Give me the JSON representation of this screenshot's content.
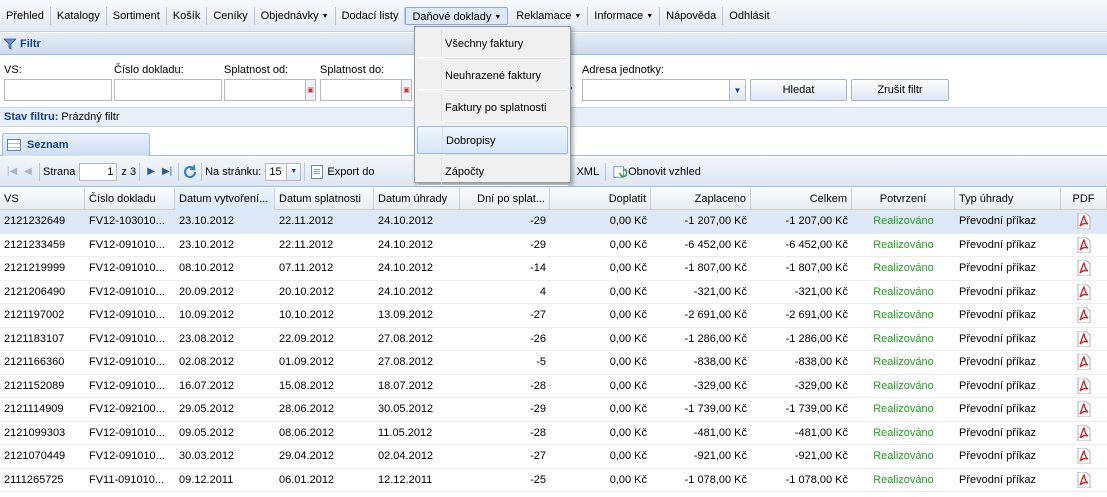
{
  "nav": [
    {
      "label": "Přehled",
      "caret": ""
    },
    {
      "label": "Katalogy",
      "caret": ""
    },
    {
      "label": "Sortiment",
      "caret": ""
    },
    {
      "label": "Košík",
      "caret": ""
    },
    {
      "label": "Ceníky",
      "caret": ""
    },
    {
      "label": "Objednávky",
      "caret": "▼"
    },
    {
      "label": "Dodací listy",
      "caret": ""
    },
    {
      "label": "Daňové doklady",
      "caret": "▼"
    },
    {
      "label": "Reklamace",
      "caret": "▼"
    },
    {
      "label": "Informace",
      "caret": "▼"
    },
    {
      "label": "Nápověda",
      "caret": ""
    },
    {
      "label": "Odhlásit",
      "caret": ""
    }
  ],
  "menu": {
    "items": [
      "Všechny faktury",
      "Neuhrazené faktury",
      "Faktury po splatnosti",
      "Dobropisy",
      "Zápočty"
    ]
  },
  "filter": {
    "title": "Filtr",
    "labels": {
      "vs": "VS:",
      "cislo": "Číslo dokladu:",
      "od": "Splatnost od:",
      "do": "Splatnost do:",
      "adresa": "Adresa jednotky:"
    },
    "search_button": "Hledat",
    "clear_button": "Zrušit filtr",
    "status_label": "Stav filtru:",
    "status_value": "Prázdný filtr"
  },
  "tab": {
    "label": "Seznam"
  },
  "toolbar": {
    "page_label": "Strana",
    "page_value": "1",
    "page_of": "z 3",
    "per_page_label": "Na stránku:",
    "per_page_value": "15",
    "export_label": "Export do",
    "xml_label": "XML",
    "refresh_label": "Obnovit vzhled"
  },
  "columns": [
    "VS",
    "Číslo dokladu",
    "Datum vytvoření...",
    "Datum splatnosti",
    "Datum úhrady",
    "Dní po splat...",
    "Doplatit",
    "Zaplaceno",
    "Celkem",
    "Potvrzení",
    "Typ úhrady",
    "PDF"
  ],
  "rows": [
    {
      "vs": "2121232649",
      "cislo": "FV12-103010...",
      "vytvoreni": "23.10.2012",
      "splatnost": "22.11.2012",
      "uhrada": "24.10.2012",
      "dni": "-29",
      "doplatit": "0,00 Kč",
      "zaplaceno": "-1 207,00 Kč",
      "celkem": "-1 207,00 Kč",
      "potvrzeni": "Realizováno",
      "typ": "Převodní příkaz"
    },
    {
      "vs": "2121233459",
      "cislo": "FV12-091010...",
      "vytvoreni": "23.10.2012",
      "splatnost": "22.11.2012",
      "uhrada": "24.10.2012",
      "dni": "-29",
      "doplatit": "0,00 Kč",
      "zaplaceno": "-6 452,00 Kč",
      "celkem": "-6 452,00 Kč",
      "potvrzeni": "Realizováno",
      "typ": "Převodní příkaz"
    },
    {
      "vs": "2121219999",
      "cislo": "FV12-091010...",
      "vytvoreni": "08.10.2012",
      "splatnost": "07.11.2012",
      "uhrada": "24.10.2012",
      "dni": "-14",
      "doplatit": "0,00 Kč",
      "zaplaceno": "-1 807,00 Kč",
      "celkem": "-1 807,00 Kč",
      "potvrzeni": "Realizováno",
      "typ": "Převodní příkaz"
    },
    {
      "vs": "2121206490",
      "cislo": "FV12-091010...",
      "vytvoreni": "20.09.2012",
      "splatnost": "20.10.2012",
      "uhrada": "24.10.2012",
      "dni": "4",
      "doplatit": "0,00 Kč",
      "zaplaceno": "-321,00 Kč",
      "celkem": "-321,00 Kč",
      "potvrzeni": "Realizováno",
      "typ": "Převodní příkaz"
    },
    {
      "vs": "2121197002",
      "cislo": "FV12-091010...",
      "vytvoreni": "10.09.2012",
      "splatnost": "10.10.2012",
      "uhrada": "13.09.2012",
      "dni": "-27",
      "doplatit": "0,00 Kč",
      "zaplaceno": "-2 691,00 Kč",
      "celkem": "-2 691,00 Kč",
      "potvrzeni": "Realizováno",
      "typ": "Převodní příkaz"
    },
    {
      "vs": "2121183107",
      "cislo": "FV12-091010...",
      "vytvoreni": "23.08.2012",
      "splatnost": "22.09.2012",
      "uhrada": "27.08.2012",
      "dni": "-26",
      "doplatit": "0,00 Kč",
      "zaplaceno": "-1 286,00 Kč",
      "celkem": "-1 286,00 Kč",
      "potvrzeni": "Realizováno",
      "typ": "Převodní příkaz"
    },
    {
      "vs": "2121166360",
      "cislo": "FV12-091010...",
      "vytvoreni": "02.08.2012",
      "splatnost": "01.09.2012",
      "uhrada": "27.08.2012",
      "dni": "-5",
      "doplatit": "0,00 Kč",
      "zaplaceno": "-838,00 Kč",
      "celkem": "-838,00 Kč",
      "potvrzeni": "Realizováno",
      "typ": "Převodní příkaz"
    },
    {
      "vs": "2121152089",
      "cislo": "FV12-091010...",
      "vytvoreni": "16.07.2012",
      "splatnost": "15.08.2012",
      "uhrada": "18.07.2012",
      "dni": "-28",
      "doplatit": "0,00 Kč",
      "zaplaceno": "-329,00 Kč",
      "celkem": "-329,00 Kč",
      "potvrzeni": "Realizováno",
      "typ": "Převodní příkaz"
    },
    {
      "vs": "2121114909",
      "cislo": "FV12-092100...",
      "vytvoreni": "29.05.2012",
      "splatnost": "28.06.2012",
      "uhrada": "30.05.2012",
      "dni": "-29",
      "doplatit": "0,00 Kč",
      "zaplaceno": "-1 739,00 Kč",
      "celkem": "-1 739,00 Kč",
      "potvrzeni": "Realizováno",
      "typ": "Převodní příkaz"
    },
    {
      "vs": "2121099303",
      "cislo": "FV12-091010...",
      "vytvoreni": "09.05.2012",
      "splatnost": "08.06.2012",
      "uhrada": "11.05.2012",
      "dni": "-28",
      "doplatit": "0,00 Kč",
      "zaplaceno": "-481,00 Kč",
      "celkem": "-481,00 Kč",
      "potvrzeni": "Realizováno",
      "typ": "Převodní příkaz"
    },
    {
      "vs": "2121070449",
      "cislo": "FV12-091010...",
      "vytvoreni": "30.03.2012",
      "splatnost": "29.04.2012",
      "uhrada": "02.04.2012",
      "dni": "-27",
      "doplatit": "0,00 Kč",
      "zaplaceno": "-921,00 Kč",
      "celkem": "-921,00 Kč",
      "potvrzeni": "Realizováno",
      "typ": "Převodní příkaz"
    },
    {
      "vs": "2111265725",
      "cislo": "FV11-091010...",
      "vytvoreni": "09.12.2011",
      "splatnost": "06.01.2012",
      "uhrada": "12.12.2011",
      "dni": "-25",
      "doplatit": "0,00 Kč",
      "zaplaceno": "-1 078,00 Kč",
      "celkem": "-1 078,00 Kč",
      "potvrzeni": "Realizováno",
      "typ": "Převodní příkaz"
    }
  ],
  "colors": {
    "accent": "#15428b",
    "confirmed": "#22a222",
    "selected_row": "#dfe8f6"
  }
}
